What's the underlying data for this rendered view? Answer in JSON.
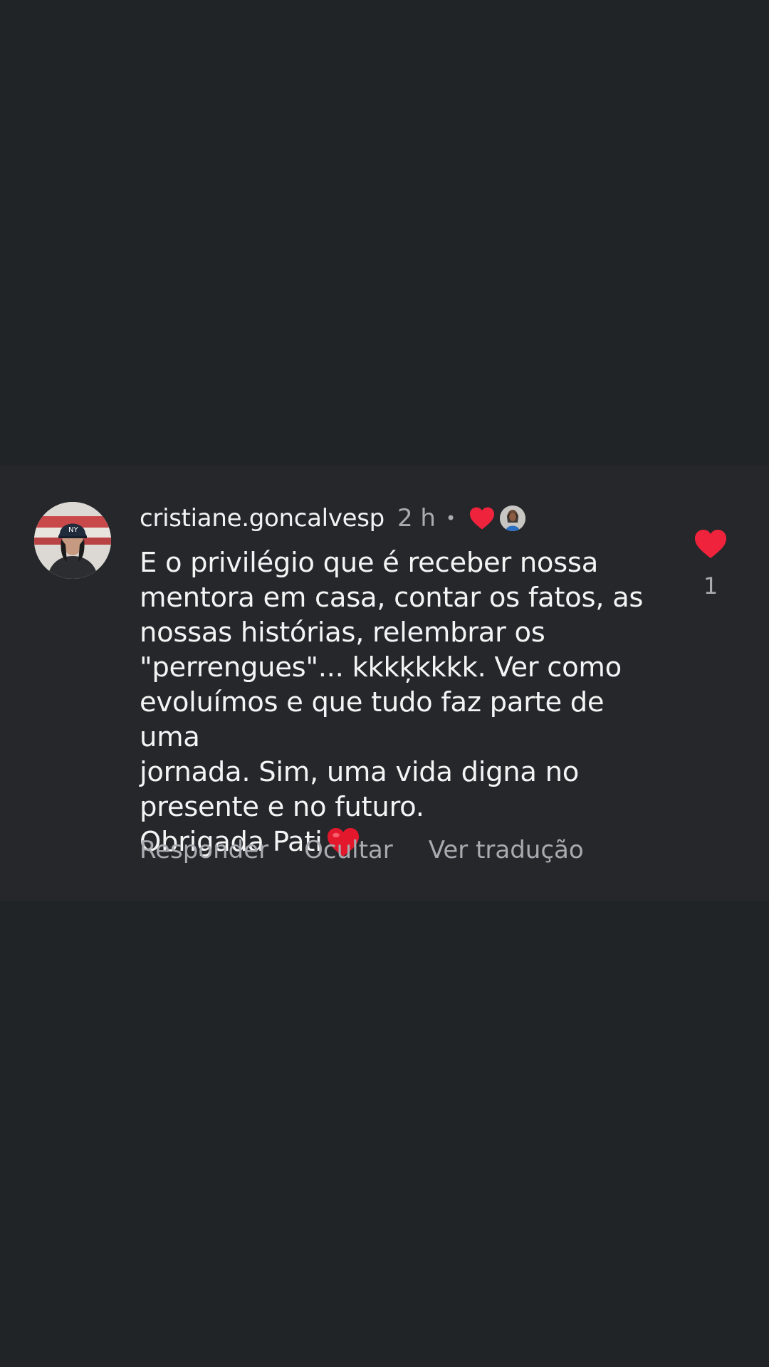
{
  "comment": {
    "username": "cristiane.goncalvesp",
    "time": "2 h",
    "separator": "•",
    "text": "E o privilégio que é receber nossa\nmentora em casa, contar os fatos, as\nnossas histórias, relembrar os\n\"perrengues\"... kkkķkkkk. Ver como\nevoluímos e que tudo faz parte de uma\njornada. Sim, uma vida digna no\npresente e no futuro.\nObrigada Pati",
    "like_count": "1",
    "liked": true,
    "liked_by_creator": true
  },
  "actions": {
    "reply": "Responder",
    "hide": "Ocultar",
    "translate": "Ver tradução"
  },
  "colors": {
    "background": "#202427",
    "card": "#25272b",
    "heart": "#f0233d",
    "muted_text": "#a8acb1",
    "primary_text": "#f4f4f4"
  },
  "icons": {
    "like": "heart-icon",
    "creator_like": "heart-icon",
    "emoji": "red-heart-emoji"
  }
}
